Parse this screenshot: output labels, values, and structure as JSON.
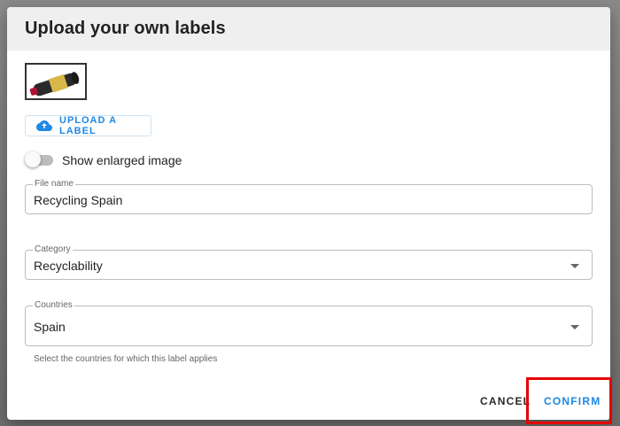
{
  "dialog": {
    "title": "Upload your own labels"
  },
  "thumbnail": {
    "icon": "label-bottle-thumbnail"
  },
  "upload": {
    "label": "UPLOAD A LABEL",
    "icon": "cloud-upload-icon"
  },
  "toggle": {
    "label": "Show enlarged image",
    "enabled": false
  },
  "fields": {
    "file_name": {
      "label": "File name",
      "value": "Recycling Spain"
    },
    "category": {
      "label": "Category",
      "value": "Recyclability"
    },
    "countries": {
      "label": "Countries",
      "value": "Spain",
      "helper": "Select the countries for which this label applies"
    }
  },
  "actions": {
    "cancel": "CANCEL",
    "confirm": "CONFIRM"
  },
  "colors": {
    "accent": "#1e88e5",
    "highlight": "#e60000",
    "header": "#efefef"
  }
}
